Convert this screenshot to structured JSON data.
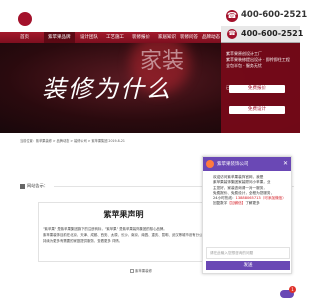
{
  "header": {
    "hotline": "400-600-2521",
    "phone_icon": "phone-icon"
  },
  "nav": {
    "items": [
      {
        "label": "首页",
        "active": false
      },
      {
        "label": "紫苹果品牌",
        "active": true
      },
      {
        "label": "设计团队",
        "active": false
      },
      {
        "label": "工艺施工",
        "active": false
      },
      {
        "label": "装修报价",
        "active": false
      },
      {
        "label": "家居知识",
        "active": false
      },
      {
        "label": "装修问答",
        "active": false
      },
      {
        "label": "品牌动态",
        "active": false
      }
    ]
  },
  "banner": {
    "headline": "装修为什么",
    "headline2": "家装"
  },
  "side_panel": {
    "phone": "400-600-2521",
    "lines": [
      "紫苹果原创设计工厂",
      "紫苹果装修提出设计 · 即拎即住工程",
      "全包半包 · 服务无忧",
      "免费报价",
      "已有256位业主 成功获得报价",
      "免费设计"
    ],
    "quote_button": "免费报价",
    "design_button": "免费设计"
  },
  "breadcrumb": "当前位置：紫苹果装修 > 品牌动态 > 装修公司 > 紫苹果集团 2019-8-21",
  "announcement": {
    "label": "网站告示：",
    "text": "紫苹果声明"
  },
  "statement": {
    "title": "紫苹果声明",
    "lines": [
      "\"紫苹果\" 是紫苹果集团旗下的注册商标，\"紫苹果\" 是紫苹果装饰集团的核心品牌。",
      "紫苹果装饰目前在北京、天津、成都、西安、太原、长沙、南京、南昌、重庆、昆明、武汉等城市设有分公司，",
      "持续为更多有需要的家庭提供服务，查看更多 详情。"
    ],
    "red_tail": "更多详情"
  },
  "bottom_link": "紫苹果装修",
  "chat": {
    "title": "紫苹果装饰公司",
    "close": "✕",
    "lines": [
      "欢迎访问紫苹果装饰官网，我是",
      "紫苹果装饰集团家装顾问小苹果，业",
      "主您好，家装咨询请一对一服务，",
      "免费报价、免费设计，全程为您服务，",
      "24小时热线："
    ],
    "hotline": "13888065713（可添加微信）",
    "more_prefix": "回复数字",
    "more_link": "【加微信】",
    "more_suffix": "了解更多",
    "input_placeholder": "请在此输入您想咨询的问题",
    "send": "发送",
    "badge": "1"
  }
}
